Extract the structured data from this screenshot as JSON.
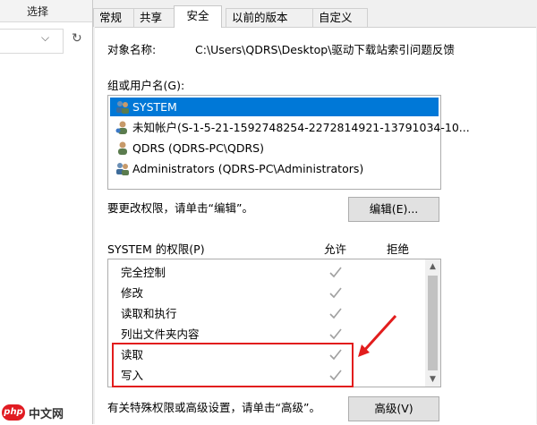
{
  "background_window": {
    "ribbon_label": "选择",
    "chevron": "⌵",
    "refresh": "↻"
  },
  "dialog": {
    "tabs": [
      "常规",
      "共享",
      "安全",
      "以前的版本",
      "自定义"
    ],
    "active_tab": "安全",
    "object_name_label": "对象名称:",
    "object_path": "C:\\Users\\QDRS\\Desktop\\驱动下载站索引问题反馈",
    "group_label": "组或用户名(G):",
    "users": [
      {
        "name": "SYSTEM",
        "icon": "users-group-icon",
        "selected": true
      },
      {
        "name": "未知帐户(S-1-5-21-1592748254-2272814921-13791034-10...",
        "icon": "unknown-user-icon",
        "selected": false
      },
      {
        "name": "QDRS (QDRS-PC\\QDRS)",
        "icon": "user-icon",
        "selected": false
      },
      {
        "name": "Administrators (QDRS-PC\\Administrators)",
        "icon": "users-group-icon",
        "selected": false
      }
    ],
    "change_perm_text": "要更改权限，请单击“编辑”。",
    "edit_button": "编辑(E)...",
    "perm_header": "SYSTEM 的权限(P)",
    "allow_header": "允许",
    "deny_header": "拒绝",
    "permissions": [
      {
        "name": "完全控制",
        "allow": true,
        "deny": false
      },
      {
        "name": "修改",
        "allow": true,
        "deny": false
      },
      {
        "name": "读取和执行",
        "allow": true,
        "deny": false
      },
      {
        "name": "列出文件夹内容",
        "allow": true,
        "deny": false
      },
      {
        "name": "读取",
        "allow": true,
        "deny": false
      },
      {
        "name": "写入",
        "allow": true,
        "deny": false
      }
    ],
    "advanced_text": "有关特殊权限或高级设置，请单击“高级”。",
    "advanced_button": "高级(V)",
    "highlight_color": "#e21d1d",
    "accent_color": "#0078d7"
  },
  "watermark": {
    "badge": "php",
    "text": "中文网"
  }
}
